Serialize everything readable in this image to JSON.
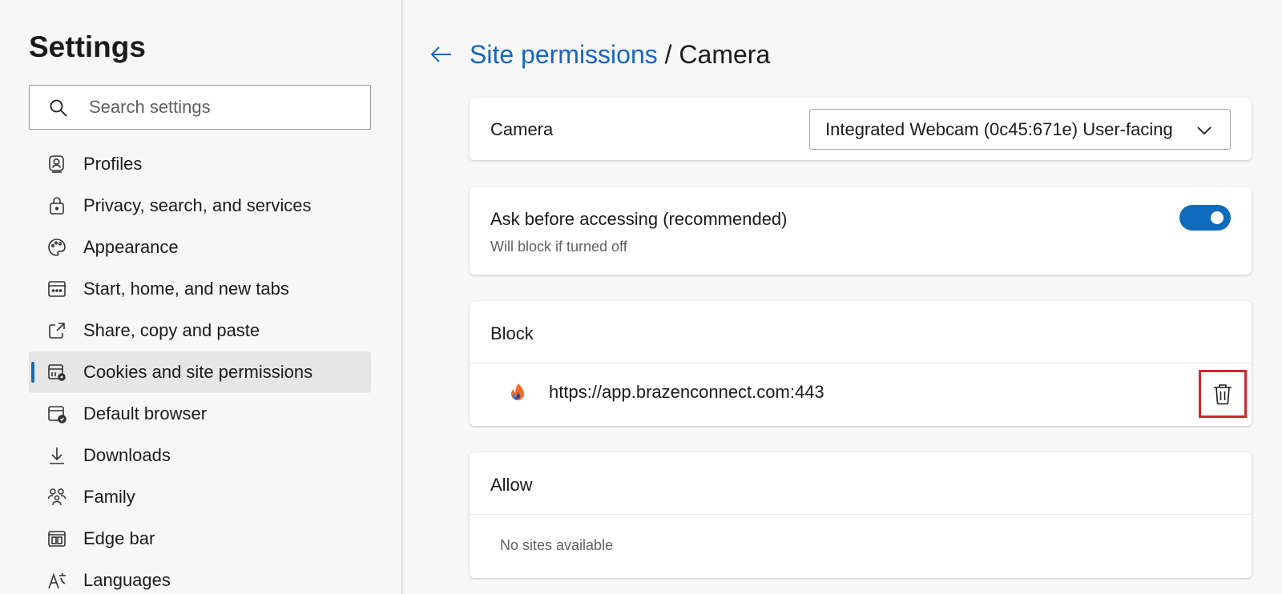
{
  "sidebar": {
    "title": "Settings",
    "search_placeholder": "Search settings",
    "items": [
      {
        "label": "Profiles",
        "icon": "profile-icon"
      },
      {
        "label": "Privacy, search, and services",
        "icon": "lock-icon"
      },
      {
        "label": "Appearance",
        "icon": "palette-icon"
      },
      {
        "label": "Start, home, and new tabs",
        "icon": "start-tabs-icon"
      },
      {
        "label": "Share, copy and paste",
        "icon": "share-icon"
      },
      {
        "label": "Cookies and site permissions",
        "icon": "cookies-icon",
        "active": true
      },
      {
        "label": "Default browser",
        "icon": "default-browser-icon"
      },
      {
        "label": "Downloads",
        "icon": "download-icon"
      },
      {
        "label": "Family",
        "icon": "family-icon"
      },
      {
        "label": "Edge bar",
        "icon": "edge-bar-icon"
      },
      {
        "label": "Languages",
        "icon": "languages-icon"
      }
    ]
  },
  "header": {
    "breadcrumb_link": "Site permissions",
    "breadcrumb_separator": " / ",
    "breadcrumb_current": "Camera"
  },
  "camera": {
    "label": "Camera",
    "selected_device": "Integrated Webcam (0c45:671e) User-facing"
  },
  "ask": {
    "label": "Ask before accessing (recommended)",
    "sublabel": "Will block if turned off",
    "enabled": true
  },
  "block": {
    "title": "Block",
    "sites": [
      {
        "url": "https://app.brazenconnect.com:443"
      }
    ]
  },
  "allow": {
    "title": "Allow",
    "empty_text": "No sites available"
  },
  "colors": {
    "accent": "#0f6cbd",
    "link": "#1565c0",
    "highlight": "#d1262c"
  }
}
